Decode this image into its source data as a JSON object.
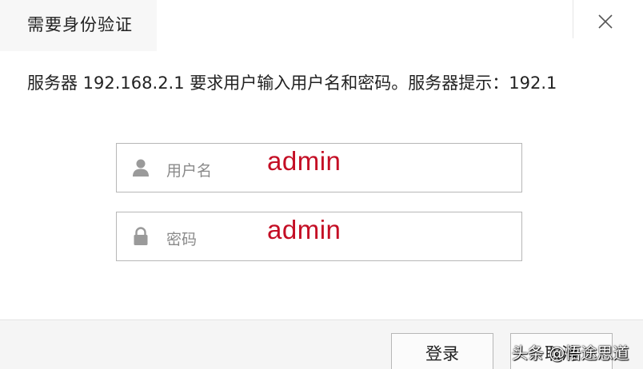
{
  "dialog": {
    "title": "需要身份验证",
    "message": "服务器 192.168.2.1 要求用户输入用户名和密码。服务器提示：192.1"
  },
  "username_field": {
    "placeholder": "用户名",
    "value": "admin",
    "icon": "user-icon"
  },
  "password_field": {
    "placeholder": "密码",
    "value": "admin",
    "icon": "lock-icon"
  },
  "buttons": {
    "login_label": "登录",
    "cancel_label": "取消"
  },
  "watermark": {
    "text": "头条 @悟途思道"
  },
  "colors": {
    "annotation_red": "#c40e25",
    "border": "#b7b7b7",
    "placeholder_gray": "#8a8a8a"
  }
}
